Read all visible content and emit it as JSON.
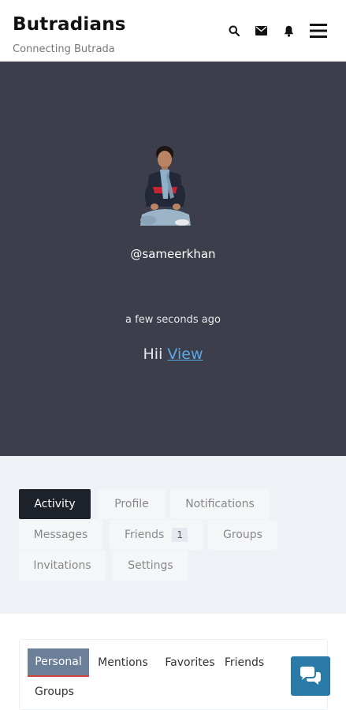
{
  "header": {
    "title": "Butradians",
    "tagline": "Connecting Butrada",
    "icons": [
      "search-icon",
      "envelope-icon",
      "bell-icon",
      "hamburger-menu-icon"
    ]
  },
  "profile": {
    "username": "@sameerkhan",
    "timestamp": "a few seconds ago",
    "status_text": "Hii",
    "status_link": "View"
  },
  "tabs": [
    {
      "label": "Activity",
      "active": true
    },
    {
      "label": "Profile"
    },
    {
      "label": "Notifications"
    },
    {
      "label": "Messages"
    },
    {
      "label": "Friends",
      "count": "1"
    },
    {
      "label": "Groups"
    },
    {
      "label": "Invitations"
    },
    {
      "label": "Settings"
    }
  ],
  "subtabs": [
    {
      "label": "Personal",
      "active": true
    },
    {
      "label": "Mentions"
    },
    {
      "label": "Favorites"
    },
    {
      "label": "Friends"
    },
    {
      "label": "Groups"
    }
  ],
  "colors": {
    "hero_bg": "#3c3f4b",
    "active_tab_bg": "#1d212a",
    "active_subtab_bg": "#6b7f99",
    "link": "#5aa8e6",
    "chat_button": "#2a7aa8"
  },
  "chat_button_icon": "chat-bubbles-icon"
}
